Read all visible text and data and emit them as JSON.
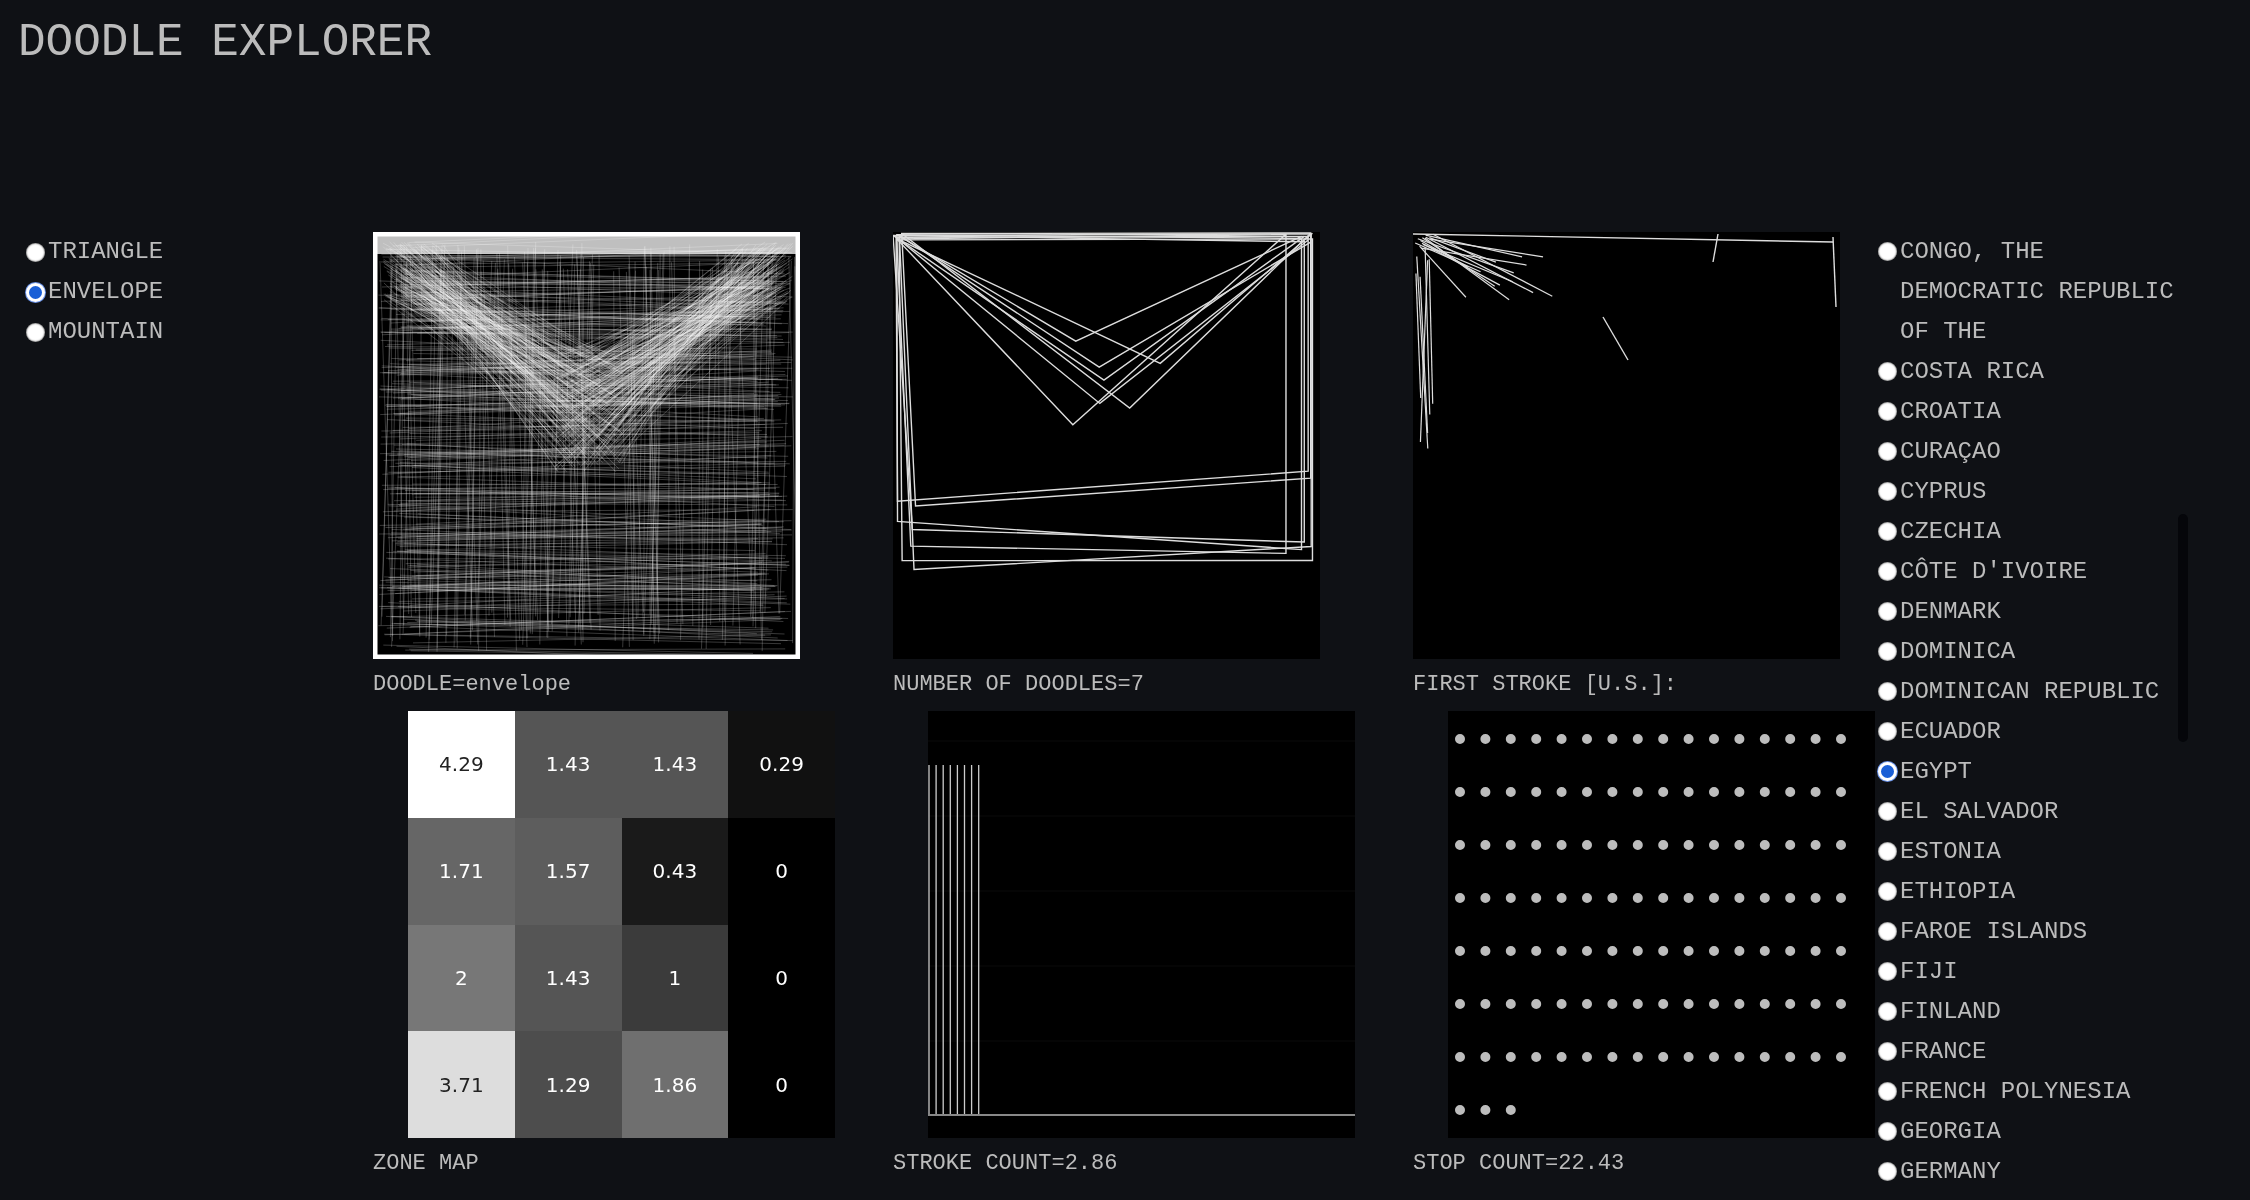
{
  "title": "DOODLE EXPLORER",
  "doodle_options": [
    {
      "label": "TRIANGLE",
      "selected": false
    },
    {
      "label": "ENVELOPE",
      "selected": true
    },
    {
      "label": "MOUNTAIN",
      "selected": false
    }
  ],
  "panels": [
    {
      "kind": "doodle-overlay",
      "caption": "DOODLE=envelope"
    },
    {
      "kind": "doodle-strokes",
      "caption": "NUMBER OF DOODLES=7"
    },
    {
      "kind": "first-stroke",
      "caption": "FIRST STROKE [U.S.]:"
    },
    {
      "kind": "zone-map",
      "caption": "ZONE MAP",
      "cells": [
        [
          "4.29",
          "1.43",
          "1.43",
          "0.29"
        ],
        [
          "1.71",
          "1.57",
          "0.43",
          "0"
        ],
        [
          "2",
          "1.43",
          "1",
          "0"
        ],
        [
          "3.71",
          "1.29",
          "1.86",
          "0"
        ]
      ]
    },
    {
      "kind": "stroke-count",
      "caption": "STROKE COUNT=2.86"
    },
    {
      "kind": "stop-count",
      "caption": "STOP COUNT=22.43"
    }
  ],
  "countries": [
    {
      "label": "CONGO, THE DEMOCRATIC REPUBLIC OF THE",
      "selected": false
    },
    {
      "label": "COSTA RICA",
      "selected": false
    },
    {
      "label": "CROATIA",
      "selected": false
    },
    {
      "label": "CURAÇAO",
      "selected": false
    },
    {
      "label": "CYPRUS",
      "selected": false
    },
    {
      "label": "CZECHIA",
      "selected": false
    },
    {
      "label": "CÔTE D'IVOIRE",
      "selected": false
    },
    {
      "label": "DENMARK",
      "selected": false
    },
    {
      "label": "DOMINICA",
      "selected": false
    },
    {
      "label": "DOMINICAN REPUBLIC",
      "selected": false
    },
    {
      "label": "ECUADOR",
      "selected": false
    },
    {
      "label": "EGYPT",
      "selected": true
    },
    {
      "label": "EL SALVADOR",
      "selected": false
    },
    {
      "label": "ESTONIA",
      "selected": false
    },
    {
      "label": "ETHIOPIA",
      "selected": false
    },
    {
      "label": "FAROE ISLANDS",
      "selected": false
    },
    {
      "label": "FIJI",
      "selected": false
    },
    {
      "label": "FINLAND",
      "selected": false
    },
    {
      "label": "FRANCE",
      "selected": false
    },
    {
      "label": "FRENCH POLYNESIA",
      "selected": false
    },
    {
      "label": "GEORGIA",
      "selected": false
    },
    {
      "label": "GERMANY",
      "selected": false
    }
  ]
}
